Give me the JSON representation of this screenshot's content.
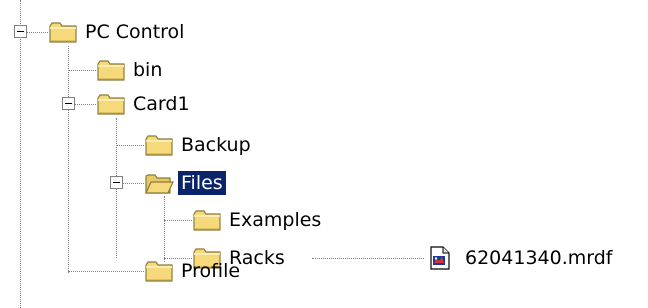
{
  "tree": {
    "nodes": [
      {
        "label": "PC Control",
        "icon": "folder-closed-icon"
      },
      {
        "label": "bin",
        "icon": "folder-closed-icon"
      },
      {
        "label": "Card1",
        "icon": "folder-closed-icon"
      },
      {
        "label": "Backup",
        "icon": "folder-closed-icon"
      },
      {
        "label": "Files",
        "icon": "folder-open-icon",
        "selected": true
      },
      {
        "label": "Examples",
        "icon": "folder-closed-icon"
      },
      {
        "label": "Racks",
        "icon": "folder-closed-icon"
      },
      {
        "label": "Profile",
        "icon": "folder-closed-icon"
      }
    ],
    "file": {
      "label": "62041340.mrdf",
      "icon": "mrdf-file-icon"
    }
  },
  "colors": {
    "folder": "#f5d97a",
    "folder_border": "#8a7a3a",
    "selection_bg": "#0a246a",
    "selection_text": "#ffffff",
    "tree_lines": "#808080"
  }
}
